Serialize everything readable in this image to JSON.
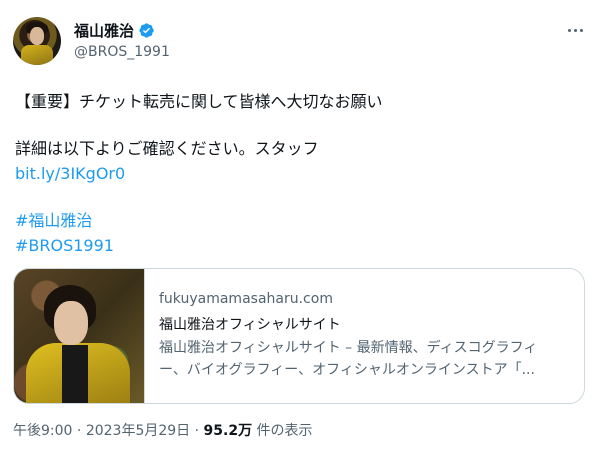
{
  "user": {
    "display_name": "福山雅治",
    "handle": "@BROS_1991"
  },
  "tweet": {
    "line1": "【重要】チケット転売に関して皆様へ大切なお願い",
    "line2": "詳細は以下よりご確認ください。スタッフ",
    "link": "bit.ly/3IKgOr0",
    "hashtag1": "#福山雅治",
    "hashtag2": "#BROS1991"
  },
  "card": {
    "domain": "fukuyamamasaharu.com",
    "title": "福山雅治オフィシャルサイト",
    "description_line1": "福山雅治オフィシャルサイト – 最新情報、ディスコグラフィ",
    "description_line2": "ー、バイオグラフィー、オフィシャルオンラインストア「..."
  },
  "meta": {
    "time": "午後9:00",
    "separator": "·",
    "date": "2023年5月29日",
    "views_count": "95.2万",
    "views_label": "件の表示"
  },
  "colors": {
    "link": "#1d9bf0",
    "verified": "#1d9bf0",
    "secondary_text": "#536471",
    "border": "#cfd9de"
  }
}
